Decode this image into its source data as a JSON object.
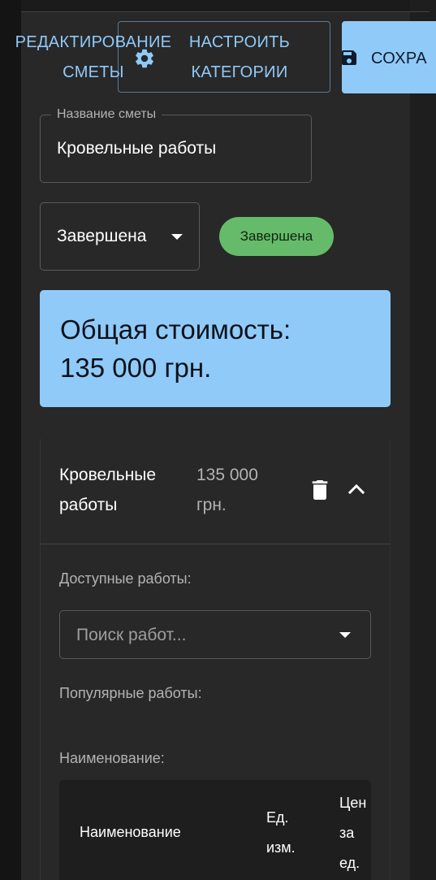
{
  "header": {
    "title_line1": "РЕДАКТИРОВАНИЕ",
    "title_line2": "СМЕТЫ",
    "configure_line1": "НАСТРОИТЬ",
    "configure_line2": "КАТЕГОРИИ",
    "save_label": "СОХРА",
    "configure_icon": "gear-icon",
    "save_icon": "floppy-disk-icon"
  },
  "estimate": {
    "name_label": "Название сметы",
    "name_value": "Кровельные работы",
    "status_value": "Завершена",
    "status_chip": "Завершена",
    "status_chip_color": "#66bb6a"
  },
  "total": {
    "line1": "Общая стоимость:",
    "line2": "135 000 грн."
  },
  "category": {
    "name_line1": "Кровельные",
    "name_line2": "работы",
    "cost_line1": "135 000",
    "cost_line2": "грн.",
    "delete_icon": "trash-icon",
    "collapse_icon": "chevron-up-icon"
  },
  "works": {
    "available_label": "Доступные работы:",
    "search_placeholder": "Поиск работ...",
    "popular_label": "Популярные работы:",
    "name_label": "Наименование:"
  },
  "table": {
    "col_name": "Наименование",
    "col_unit_line1": "Ед.",
    "col_unit_line2": "изм.",
    "col_price_line1": "Цен",
    "col_price_line2": "за",
    "col_price_line3": "ед."
  },
  "colors": {
    "accent": "#90caf9",
    "background": "#282828",
    "success": "#66bb6a"
  }
}
